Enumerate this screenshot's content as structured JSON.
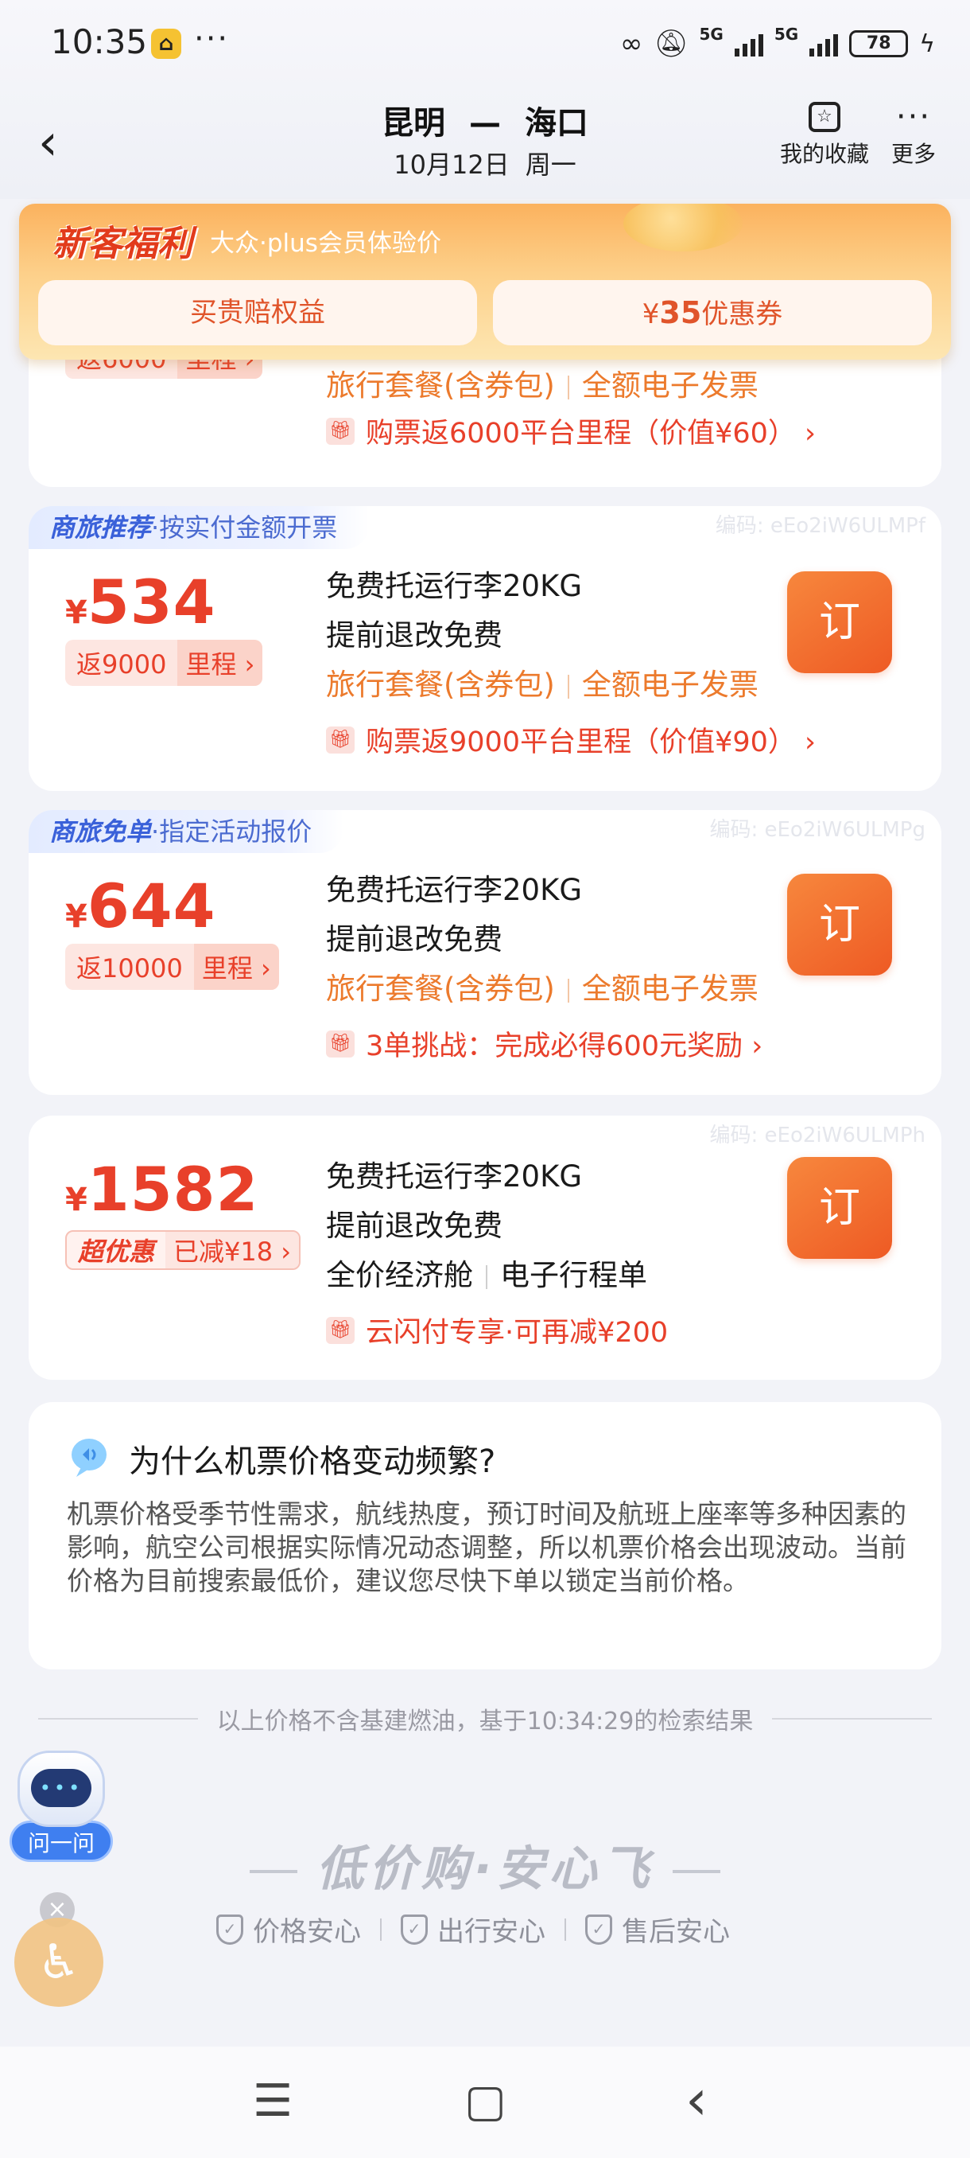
{
  "status_bar": {
    "time": "10:35",
    "app_icon": "taxi-app-icon",
    "dots": "···",
    "network1": "5G",
    "network2": "5G",
    "battery": "78"
  },
  "nav": {
    "back": "‹",
    "origin": "昆明",
    "arrow": "—",
    "destination": "海口",
    "date": "10月12日",
    "weekday": "周一",
    "favorites_label": "我的收藏",
    "more_label": "更多"
  },
  "banner": {
    "title": "新客福利",
    "subtitle": "大众·plus会员体验价",
    "button1": "买贵赔权益",
    "button2_currency": "¥",
    "button2_amount": "35",
    "button2_suffix": "优惠券"
  },
  "partial_card": {
    "pill_left": "返6000",
    "pill_right": "里程 ›",
    "line1_a": "旅行套餐(含券包)",
    "line1_b": "全额电子发票",
    "promo": "购票返6000平台里程（价值¥60） ›"
  },
  "cards": [
    {
      "tag_bold": "商旅推荐",
      "tag_text": "·按实付金额开票",
      "code": "编码: eEo2iW6ULMPf",
      "currency": "¥",
      "price": "534",
      "pill_left": "返9000",
      "pill_right": "里程 ›",
      "line1": "免费托运行李20KG",
      "line2": "提前退改免费",
      "line3_a": "旅行套餐(含券包)",
      "line3_b": "全额电子发票",
      "promo": "购票返9000平台里程（价值¥90） ›",
      "book": "订"
    },
    {
      "tag_bold": "商旅免单",
      "tag_text": "·指定活动报价",
      "code": "编码: eEo2iW6ULMPg",
      "currency": "¥",
      "price": "644",
      "pill_left": "返10000",
      "pill_right": "里程 ›",
      "line1": "免费托运行李20KG",
      "line2": "提前退改免费",
      "line3_a": "旅行套餐(含券包)",
      "line3_b": "全额电子发票",
      "promo": "3单挑战：完成必得600元奖励 ›",
      "book": "订"
    },
    {
      "code": "编码: eEo2iW6ULMPh",
      "currency": "¥",
      "price": "1582",
      "pill_left": "超优惠",
      "pill_right": "已减¥18 ›",
      "line1": "免费托运行李20KG",
      "line2": "提前退改免费",
      "line3_a": "全价经济舱",
      "line3_b": "电子行程单",
      "promo": "云闪付专享·可再减¥200",
      "book": "订"
    }
  ],
  "faq": {
    "title": "为什么机票价格变动频繁?",
    "body": "机票价格受季节性需求，航线热度，预订时间及航班上座率等多种因素的影响，航空公司根据实际情况动态调整，所以机票价格会出现波动。当前价格为目前搜索最低价，建议您尽快下单以锁定当前价格。"
  },
  "footer_note": "以上价格不含基建燃油，基于10:34:29的检索结果",
  "slogan": "低价购·安心飞",
  "assurances": [
    "价格安心",
    "出行安心",
    "售后安心"
  ],
  "assistant_label": "问一问",
  "bottom_nav": {
    "menu": "☰",
    "home": "▢",
    "back": "‹"
  },
  "colors": {
    "price_red": "#e8402a",
    "orange": "#ec7a2c",
    "book_button": "#ee5a24",
    "tag_blue": "#3a61d9"
  }
}
